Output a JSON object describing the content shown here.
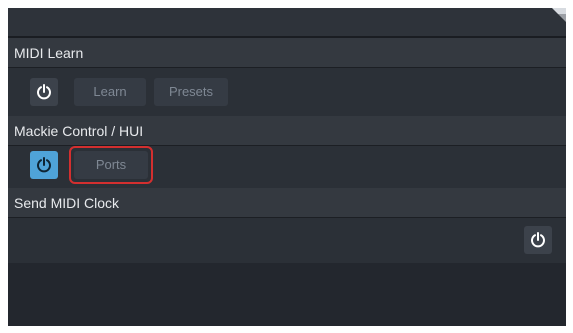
{
  "sections": [
    {
      "title": "MIDI Learn",
      "power_on": false,
      "buttons": [
        "Learn",
        "Presets"
      ]
    },
    {
      "title": "Mackie Control / HUI",
      "power_on": true,
      "buttons": [
        "Ports"
      ]
    },
    {
      "title": "Send MIDI Clock",
      "power_on": false,
      "buttons": []
    }
  ],
  "colors": {
    "accent": "#4fa3d8",
    "highlight": "#d32f2f"
  },
  "icons": {
    "power": "power-icon",
    "corner": "collapse-corner-icon"
  }
}
